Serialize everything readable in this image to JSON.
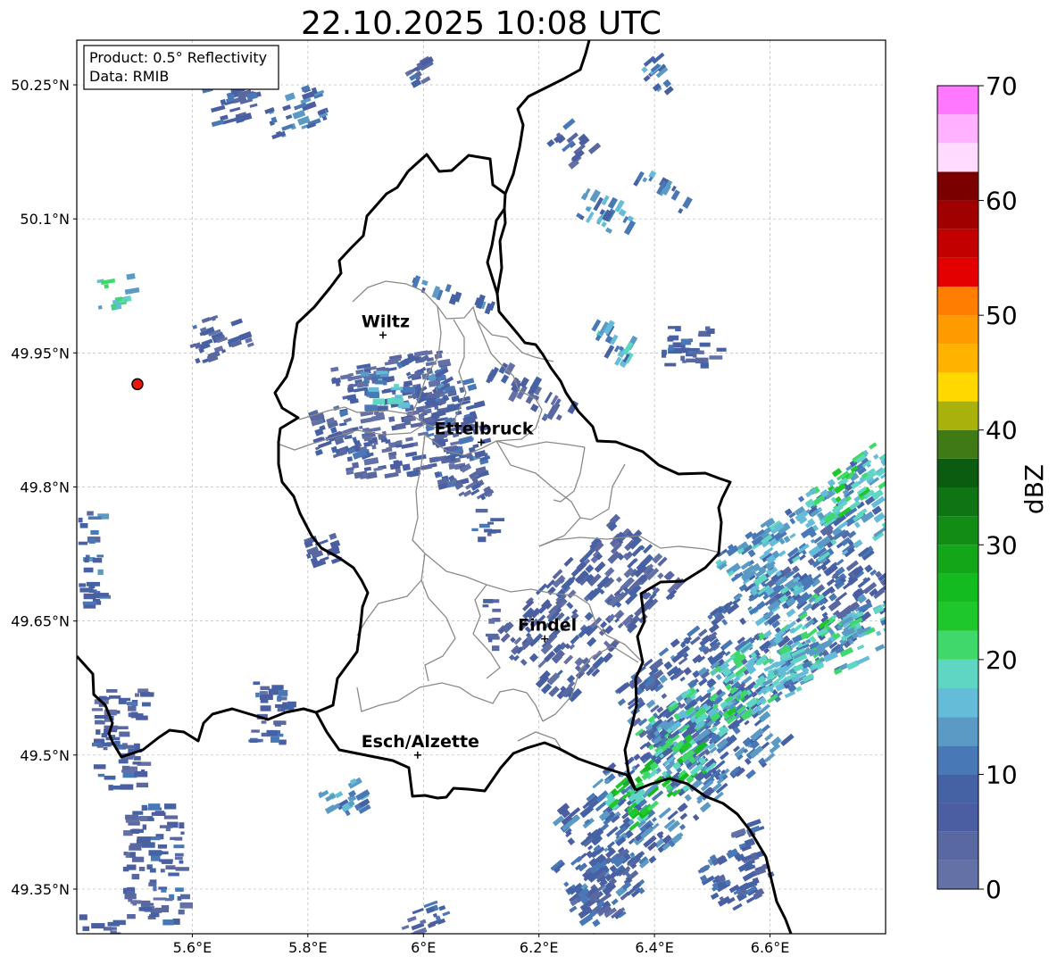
{
  "title": "22.10.2025 10:08 UTC",
  "info_box": {
    "product": "Product: 0.5° Reflectivity",
    "data": "Data: RMIB"
  },
  "map_extent": {
    "lon_min": 5.4,
    "lon_max": 6.8,
    "lat_min": 49.3,
    "lat_max": 50.3
  },
  "lat_ticks": [
    {
      "value": 50.25,
      "label": "50.25°N"
    },
    {
      "value": 50.1,
      "label": "50.1°N"
    },
    {
      "value": 49.95,
      "label": "49.95°N"
    },
    {
      "value": 49.8,
      "label": "49.8°N"
    },
    {
      "value": 49.65,
      "label": "49.65°N"
    },
    {
      "value": 49.5,
      "label": "49.5°N"
    },
    {
      "value": 49.35,
      "label": "49.35°N"
    }
  ],
  "lon_ticks": [
    {
      "value": 5.6,
      "label": "5.6°E"
    },
    {
      "value": 5.8,
      "label": "5.8°E"
    },
    {
      "value": 6.0,
      "label": "6°E"
    },
    {
      "value": 6.2,
      "label": "6.2°E"
    },
    {
      "value": 6.4,
      "label": "6.4°E"
    },
    {
      "value": 6.6,
      "label": "6.6°E"
    }
  ],
  "cities": [
    {
      "name": "Wiltz",
      "lon": 5.93,
      "lat": 49.97
    },
    {
      "name": "Ettelbruck",
      "lon": 6.1,
      "lat": 49.85
    },
    {
      "name": "Findel",
      "lon": 6.21,
      "lat": 49.63
    },
    {
      "name": "Esch/Alzette",
      "lon": 5.99,
      "lat": 49.5
    }
  ],
  "radar_site": {
    "lon": 5.505,
    "lat": 49.915,
    "color": "#e8180c"
  },
  "colorbar": {
    "label": "dBZ",
    "min": 0,
    "max": 70,
    "step": 2.5,
    "ticks": [
      0,
      10,
      20,
      30,
      40,
      50,
      60,
      70
    ],
    "colors": [
      "#6471a6",
      "#5a68a2",
      "#4a5ea1",
      "#4562a5",
      "#4878b5",
      "#5a9ac4",
      "#65bcd8",
      "#5fd6c4",
      "#3fd86a",
      "#1ec82a",
      "#14bb1e",
      "#12a618",
      "#128c14",
      "#0e7414",
      "#0b5c10",
      "#3f7a14",
      "#a9b20c",
      "#ffd800",
      "#ffb200",
      "#ff9a00",
      "#ff7d00",
      "#e40000",
      "#c20000",
      "#a10000",
      "#7a0000",
      "#ffdcff",
      "#ffb2ff",
      "#ff78ff",
      "#ee3cee"
    ]
  },
  "weather_cells": [
    {
      "lon": 6.57,
      "lat": 49.62,
      "w": 0.5,
      "h": 0.055,
      "angle": -38,
      "dbz": 8
    },
    {
      "lon": 6.42,
      "lat": 49.47,
      "w": 0.4,
      "h": 0.05,
      "angle": -40,
      "dbz": 10
    },
    {
      "lon": 6.55,
      "lat": 49.58,
      "w": 0.4,
      "h": 0.03,
      "angle": -38,
      "dbz": 18
    },
    {
      "lon": 6.66,
      "lat": 49.74,
      "w": 0.32,
      "h": 0.04,
      "angle": -35,
      "dbz": 14
    },
    {
      "lon": 6.28,
      "lat": 49.66,
      "w": 0.3,
      "h": 0.05,
      "angle": -45,
      "dbz": 5
    },
    {
      "lon": 6.4,
      "lat": 49.47,
      "w": 0.18,
      "h": 0.025,
      "angle": -40,
      "dbz": 22
    },
    {
      "lon": 6.73,
      "lat": 49.8,
      "w": 0.16,
      "h": 0.02,
      "angle": -35,
      "dbz": 20
    },
    {
      "lon": 6.7,
      "lat": 49.62,
      "w": 0.26,
      "h": 0.025,
      "angle": -25,
      "dbz": 16
    },
    {
      "lon": 6.56,
      "lat": 49.39,
      "w": 0.05,
      "h": 0.03,
      "angle": -20,
      "dbz": 6
    },
    {
      "lon": 6.29,
      "lat": 49.33,
      "w": 0.08,
      "h": 0.03,
      "angle": -35,
      "dbz": 6
    },
    {
      "lon": 6.0,
      "lat": 49.31,
      "w": 0.08,
      "h": 0.02,
      "angle": -20,
      "dbz": 6
    },
    {
      "lon": 5.95,
      "lat": 49.88,
      "w": 0.2,
      "h": 0.06,
      "angle": -10,
      "dbz": 4
    },
    {
      "lon": 6.05,
      "lat": 49.86,
      "w": 0.1,
      "h": 0.05,
      "angle": -15,
      "dbz": 8
    },
    {
      "lon": 5.84,
      "lat": 49.86,
      "w": 0.08,
      "h": 0.03,
      "angle": -20,
      "dbz": 6
    },
    {
      "lon": 5.93,
      "lat": 49.91,
      "w": 0.08,
      "h": 0.02,
      "angle": 0,
      "dbz": 14
    },
    {
      "lon": 6.07,
      "lat": 49.8,
      "w": 0.06,
      "h": 0.02,
      "angle": -30,
      "dbz": 4
    },
    {
      "lon": 5.66,
      "lat": 50.23,
      "w": 0.08,
      "h": 0.02,
      "angle": -15,
      "dbz": 8
    },
    {
      "lon": 5.77,
      "lat": 50.22,
      "w": 0.1,
      "h": 0.02,
      "angle": -20,
      "dbz": 10
    },
    {
      "lon": 5.64,
      "lat": 49.97,
      "w": 0.1,
      "h": 0.02,
      "angle": -20,
      "dbz": 6
    },
    {
      "lon": 5.46,
      "lat": 50.02,
      "w": 0.06,
      "h": 0.015,
      "angle": -10,
      "dbz": 16
    },
    {
      "lon": 5.53,
      "lat": 49.38,
      "w": 0.1,
      "h": 0.06,
      "angle": 0,
      "dbz": 6
    },
    {
      "lon": 5.47,
      "lat": 49.52,
      "w": 0.09,
      "h": 0.05,
      "angle": 0,
      "dbz": 6
    },
    {
      "lon": 5.43,
      "lat": 49.3,
      "w": 0.07,
      "h": 0.02,
      "angle": 0,
      "dbz": 6
    },
    {
      "lon": 5.86,
      "lat": 49.45,
      "w": 0.07,
      "h": 0.02,
      "angle": -30,
      "dbz": 14
    },
    {
      "lon": 6.1,
      "lat": 49.76,
      "w": 0.04,
      "h": 0.015,
      "angle": 0,
      "dbz": 6
    },
    {
      "lon": 5.82,
      "lat": 49.73,
      "w": 0.05,
      "h": 0.02,
      "angle": -20,
      "dbz": 6
    },
    {
      "lon": 6.31,
      "lat": 49.96,
      "w": 0.04,
      "h": 0.03,
      "angle": -60,
      "dbz": 14
    },
    {
      "lon": 6.46,
      "lat": 49.96,
      "w": 0.1,
      "h": 0.02,
      "angle": 0,
      "dbz": 6
    },
    {
      "lon": 6.41,
      "lat": 50.13,
      "w": 0.03,
      "h": 0.03,
      "angle": -60,
      "dbz": 12
    },
    {
      "lon": 6.31,
      "lat": 50.1,
      "w": 0.05,
      "h": 0.03,
      "angle": -60,
      "dbz": 14
    },
    {
      "lon": 6.25,
      "lat": 50.18,
      "w": 0.05,
      "h": 0.02,
      "angle": -40,
      "dbz": 6
    },
    {
      "lon": 6.4,
      "lat": 50.26,
      "w": 0.04,
      "h": 0.02,
      "angle": -40,
      "dbz": 12
    },
    {
      "lon": 5.99,
      "lat": 50.26,
      "w": 0.04,
      "h": 0.02,
      "angle": -30,
      "dbz": 6
    },
    {
      "lon": 6.3,
      "lat": 49.36,
      "w": 0.12,
      "h": 0.04,
      "angle": -40,
      "dbz": 8
    },
    {
      "lon": 6.52,
      "lat": 49.36,
      "w": 0.08,
      "h": 0.03,
      "angle": -30,
      "dbz": 8
    },
    {
      "lon": 6.11,
      "lat": 49.65,
      "w": 0.02,
      "h": 0.03,
      "angle": 0,
      "dbz": 6
    },
    {
      "lon": 6.18,
      "lat": 49.9,
      "w": 0.04,
      "h": 0.05,
      "angle": -60,
      "dbz": 6
    },
    {
      "lon": 6.05,
      "lat": 50.01,
      "w": 0.02,
      "h": 0.05,
      "angle": -70,
      "dbz": 10
    },
    {
      "lon": 6.0,
      "lat": 49.92,
      "w": 0.06,
      "h": 0.03,
      "angle": -30,
      "dbz": 8
    },
    {
      "lon": 5.73,
      "lat": 49.55,
      "w": 0.07,
      "h": 0.03,
      "angle": 0,
      "dbz": 6
    },
    {
      "lon": 5.42,
      "lat": 49.72,
      "w": 0.04,
      "h": 0.05,
      "angle": 0,
      "dbz": 8
    }
  ]
}
